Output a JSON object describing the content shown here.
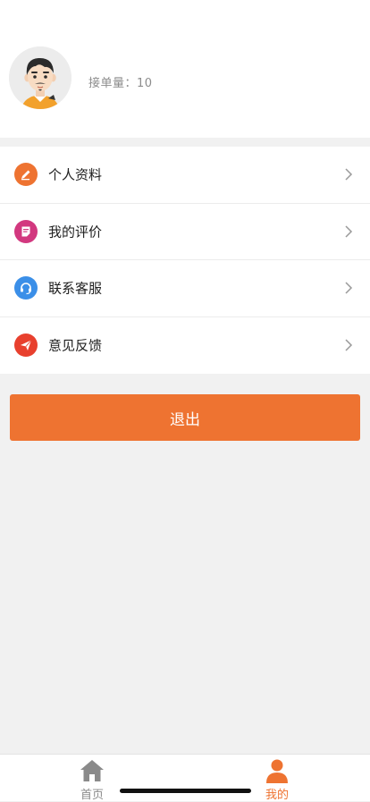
{
  "profile": {
    "order_count_label": "接单量：",
    "order_count": "10"
  },
  "menu": {
    "items": [
      {
        "label": "个人资料",
        "icon": "edit-icon",
        "color": "#ee7331"
      },
      {
        "label": "我的评价",
        "icon": "review-icon",
        "color": "#d2387f"
      },
      {
        "label": "联系客服",
        "icon": "headset-icon",
        "color": "#3b8fe8"
      },
      {
        "label": "意见反馈",
        "icon": "paper-plane-icon",
        "color": "#e8402e"
      }
    ]
  },
  "logout_label": "退出",
  "tabbar": {
    "tabs": [
      {
        "label": "首页",
        "icon": "home-icon",
        "active": false,
        "color": "#8a8a8a"
      },
      {
        "label": "我的",
        "icon": "person-icon",
        "active": true,
        "color": "#ee7331"
      }
    ]
  },
  "colors": {
    "accent": "#ee7331",
    "background": "#f1f1f1"
  }
}
